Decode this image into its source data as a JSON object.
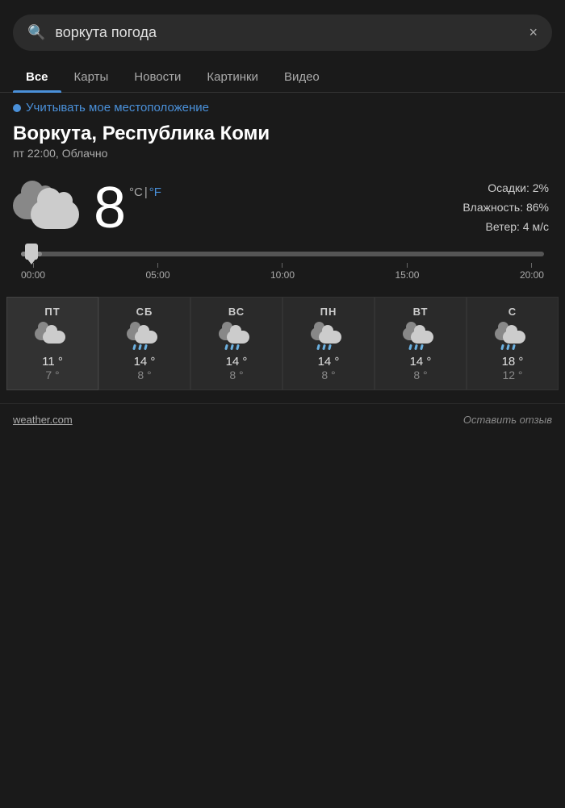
{
  "search": {
    "query": "воркута погода",
    "placeholder": "воркута погода",
    "clear_icon": "×"
  },
  "tabs": {
    "items": [
      {
        "label": "Все",
        "active": true
      },
      {
        "label": "Карты",
        "active": false
      },
      {
        "label": "Новости",
        "active": false
      },
      {
        "label": "Картинки",
        "active": false
      },
      {
        "label": "Видео",
        "active": false
      }
    ]
  },
  "location_link": {
    "label": "Учитывать мое местоположение"
  },
  "city": {
    "name": "Воркута, Республика Коми",
    "datetime": "пт 22:00, Облачно"
  },
  "weather": {
    "temperature": "8",
    "unit_celsius": "°C",
    "unit_separator": " | ",
    "unit_fahrenheit": "°F",
    "precipitation": "Осадки: 2%",
    "humidity": "Влажность: 86%",
    "wind": "Ветер: 4 м/с"
  },
  "timeline": {
    "ticks": [
      "00:00",
      "05:00",
      "10:00",
      "15:00",
      "20:00"
    ]
  },
  "forecast": {
    "days": [
      {
        "name": "ПТ",
        "high": "11 °",
        "low": "7 °",
        "type": "cloudy",
        "today": true
      },
      {
        "name": "СБ",
        "high": "14 °",
        "low": "8 °",
        "type": "rain",
        "today": false
      },
      {
        "name": "ВС",
        "high": "14 °",
        "low": "8 °",
        "type": "rain",
        "today": false
      },
      {
        "name": "ПН",
        "high": "14 °",
        "low": "8 °",
        "type": "rain",
        "today": false
      },
      {
        "name": "ВТ",
        "high": "14 °",
        "low": "8 °",
        "type": "rain",
        "today": false
      },
      {
        "name": "С",
        "high": "18 °",
        "low": "12 °",
        "type": "rain",
        "today": false
      }
    ]
  },
  "footer": {
    "source": "weather.com",
    "feedback": "Оставить отзыв"
  }
}
